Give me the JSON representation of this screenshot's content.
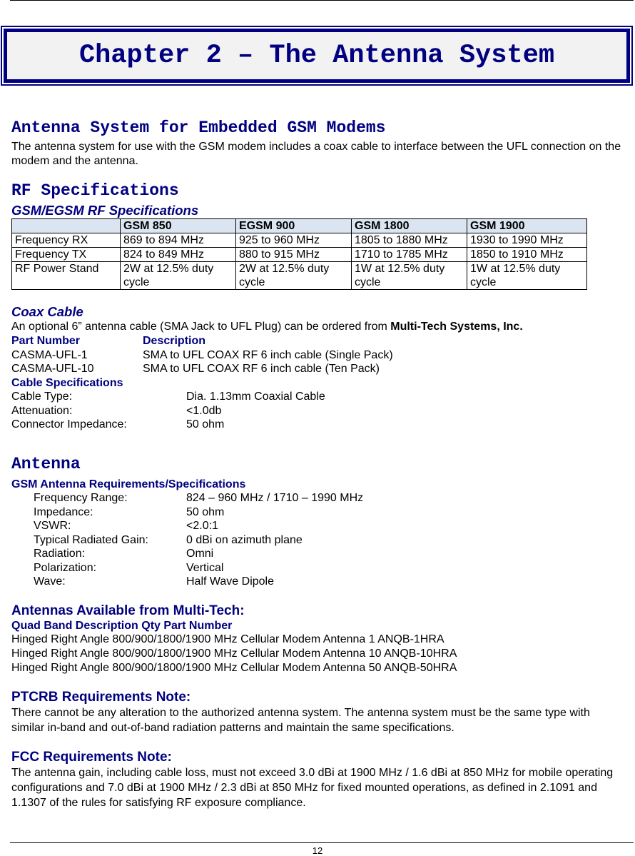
{
  "chapter_title": "Chapter 2 – The Antenna System",
  "section1": {
    "heading": "Antenna System for Embedded GSM Modems",
    "body": "The antenna system for use with the GSM modem includes a coax cable to interface between the UFL connection on the modem and the antenna."
  },
  "rf": {
    "heading": "RF Specifications",
    "subheading": "GSM/EGSM RF Specifications",
    "table": {
      "headers": [
        "",
        "GSM 850",
        "EGSM 900",
        "GSM 1800",
        "GSM 1900"
      ],
      "rows": [
        [
          "Frequency RX",
          "869 to 894 MHz",
          "925 to 960 MHz",
          "1805 to 1880 MHz",
          "1930 to 1990 MHz"
        ],
        [
          "Frequency TX",
          "824 to 849 MHz",
          "880 to 915 MHz",
          "1710 to 1785 MHz",
          "1850 to 1910 MHz"
        ],
        [
          "RF Power Stand",
          "2W at 12.5% duty cycle",
          "2W at 12.5% duty cycle",
          "1W at 12.5% duty cycle",
          "1W at 12.5% duty cycle"
        ]
      ]
    }
  },
  "coax": {
    "heading": "Coax Cable",
    "intro": "An optional 6” antenna cable (SMA Jack to UFL Plug) can be ordered from ",
    "intro_bold": "Multi-Tech Systems, Inc.",
    "parts_header": [
      "Part Number",
      "Description"
    ],
    "parts": [
      [
        "CASMA-UFL-1",
        "SMA to UFL COAX RF 6 inch cable (Single Pack)"
      ],
      [
        "CASMA-UFL-10",
        "SMA to UFL COAX RF 6 inch cable (Ten Pack)"
      ]
    ],
    "specs_heading": "Cable Specifications",
    "specs": [
      [
        "Cable Type:",
        "Dia. 1.13mm Coaxial Cable"
      ],
      [
        "Attenuation:",
        "<1.0db"
      ],
      [
        "Connector Impedance:",
        "50 ohm"
      ]
    ]
  },
  "antenna": {
    "heading": "Antenna",
    "req_heading": "GSM Antenna Requirements/Specifications",
    "specs": [
      [
        "Frequency Range:",
        "824 – 960 MHz / 1710 – 1990 MHz"
      ],
      [
        "Impedance:",
        "50 ohm"
      ],
      [
        "VSWR:",
        "<2.0:1"
      ],
      [
        "Typical Radiated Gain:",
        "0 dBi on azimuth plane"
      ],
      [
        "Radiation:",
        "Omni"
      ],
      [
        "Polarization:",
        "Vertical"
      ],
      [
        "Wave:",
        "Half Wave Dipole"
      ]
    ]
  },
  "available": {
    "heading": "Antennas Available from Multi-Tech:",
    "columns": "Quad Band Description Qty Part Number",
    "items": [
      "Hinged Right Angle 800/900/1800/1900 MHz Cellular Modem Antenna 1 ANQB-1HRA",
      "Hinged Right Angle 800/900/1800/1900 MHz Cellular Modem Antenna 10 ANQB-10HRA",
      "Hinged Right Angle 800/900/1800/1900 MHz Cellular Modem Antenna 50 ANQB-50HRA"
    ]
  },
  "ptcrb": {
    "heading": "PTCRB Requirements Note:",
    "body": "There cannot be any alteration to the authorized antenna system. The antenna system must be the same type with similar in-band and out-of-band radiation patterns and maintain the same specifications."
  },
  "fcc": {
    "heading": "FCC Requirements Note:",
    "body": "The antenna gain, including cable loss, must not exceed 3.0 dBi at 1900 MHz / 1.6 dBi at 850 MHz for mobile operating configurations and 7.0 dBi at 1900 MHz / 2.3 dBi at 850 MHz for fixed mounted operations, as defined in 2.1091 and 1.1307 of the rules for satisfying RF exposure compliance."
  },
  "page_number": "12"
}
